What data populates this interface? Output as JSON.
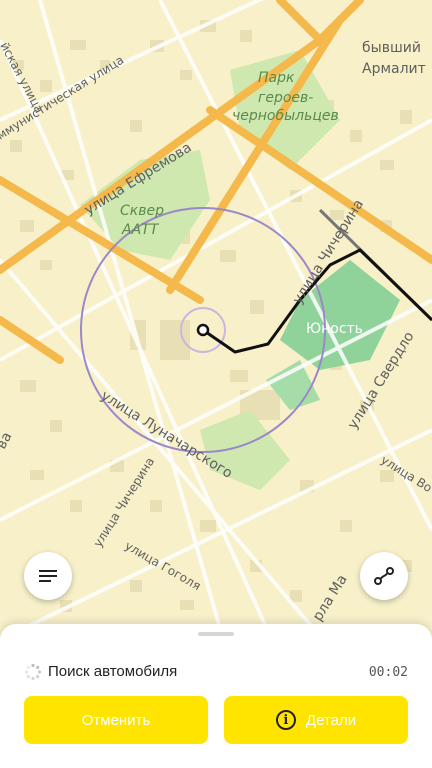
{
  "map": {
    "labels": {
      "formerArmalit": "бывший",
      "formerArmalit2": "Армалит",
      "park1": "Парк",
      "park2": "героев-",
      "park3": "чернобыльцев",
      "efremova": "улица Ефремова",
      "skver1": "Сквер",
      "skver2": "ААТТ",
      "kommun": "Коммунистическая улица",
      "kommun2": "ммунистическая улица",
      "chicherinaTop": "улица Чичерина",
      "yunost": "Юность",
      "lunacharskogo": "улица Луначарского",
      "sverdlova": "улица Свердло",
      "chicherinaBottom": "улица Чичерина",
      "gogolya": "улица Гоголя",
      "volod": "улица Во",
      "marksa": "рла Ма",
      "topLeft": "йская улица",
      "leftEdge": "ва"
    }
  },
  "menu_icon": "menu-icon",
  "route_icon": "route-icon",
  "panel": {
    "status": "Поиск автомобиля",
    "timer": "00:02",
    "cancel": "Отменить",
    "details": "Детали"
  },
  "colors": {
    "accent": "#ffe400",
    "map_bg": "#f7f0c9",
    "park": "#cfe8b0",
    "stadium": "#8fd39a",
    "road_major": "#f4b94a",
    "search_circle": "#9b88c9"
  }
}
